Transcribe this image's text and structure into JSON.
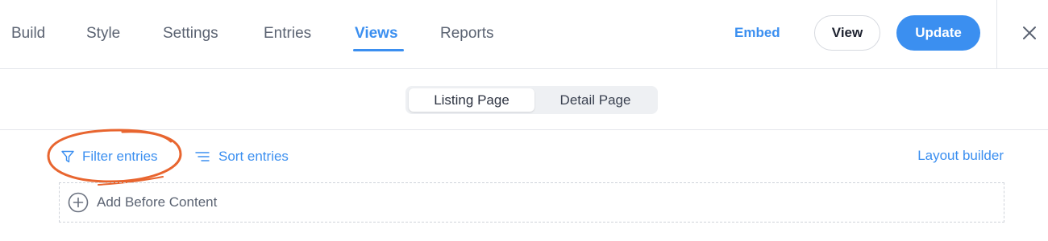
{
  "nav": {
    "tabs": [
      {
        "label": "Build",
        "active": false
      },
      {
        "label": "Style",
        "active": false
      },
      {
        "label": "Settings",
        "active": false
      },
      {
        "label": "Entries",
        "active": false
      },
      {
        "label": "Views",
        "active": true
      },
      {
        "label": "Reports",
        "active": false
      }
    ],
    "embed_label": "Embed",
    "view_label": "View",
    "update_label": "Update",
    "close_icon": "close-icon"
  },
  "page_toggle": {
    "options": [
      {
        "label": "Listing Page",
        "selected": true
      },
      {
        "label": "Detail Page",
        "selected": false
      }
    ]
  },
  "actions": {
    "filter_label": "Filter entries",
    "filter_icon": "filter-funnel-icon",
    "sort_label": "Sort entries",
    "sort_icon": "sort-lines-icon",
    "layout_label": "Layout builder"
  },
  "content": {
    "add_before_label": "Add Before Content",
    "add_icon": "plus-circle-icon"
  },
  "colors": {
    "accent": "#3b8ff0",
    "annotation": "#e8652f",
    "text_muted": "#5b6372",
    "border": "#e4e6eb"
  }
}
